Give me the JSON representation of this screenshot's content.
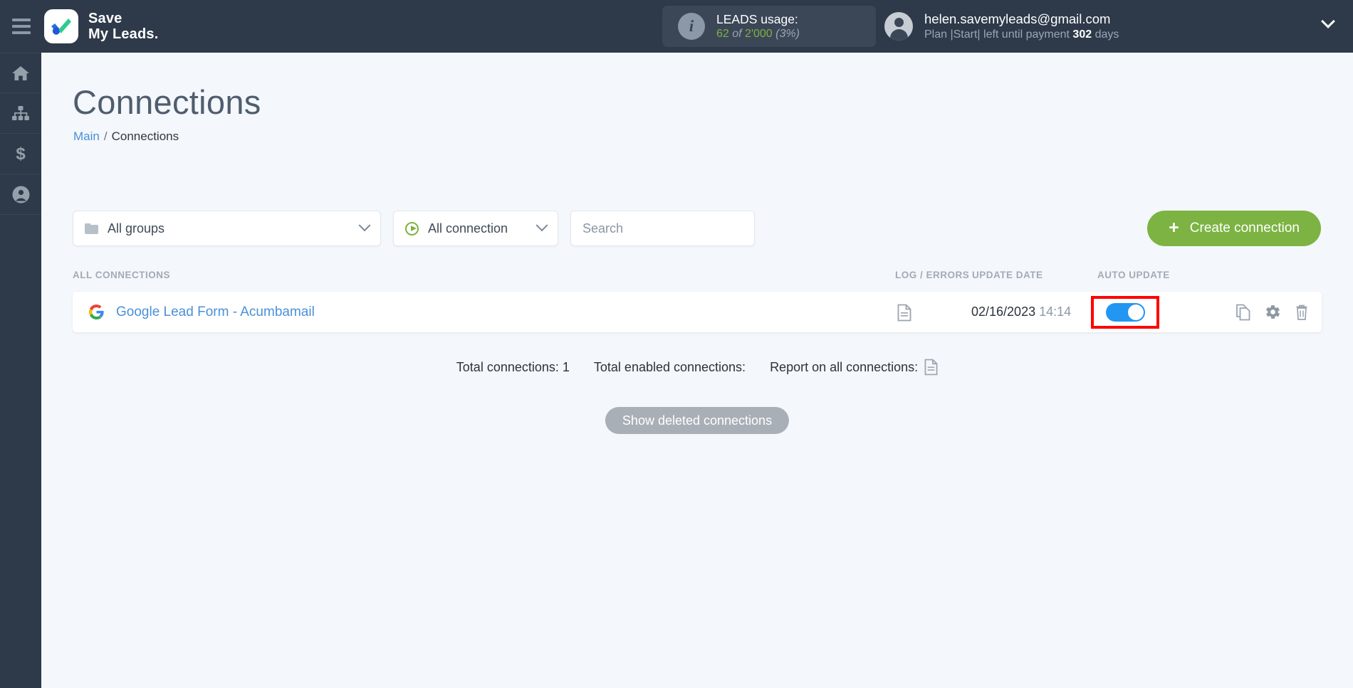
{
  "header": {
    "menu_icon": "hamburger-icon",
    "brand_line1": "Save",
    "brand_line2": "My Leads.",
    "leads": {
      "label": "LEADS usage:",
      "used": "62",
      "of": "of",
      "total": "2'000",
      "percent": "(3%)",
      "info_icon": "info-icon"
    },
    "account": {
      "email": "helen.savemyleads@gmail.com",
      "plan_prefix": "Plan |Start| left until payment",
      "days_value": "302",
      "days_suffix": "days",
      "avatar_icon": "user-avatar-icon",
      "chevron_icon": "chevron-down-icon"
    }
  },
  "sidebar": {
    "items": [
      {
        "name": "home",
        "icon": "home-icon"
      },
      {
        "name": "connections",
        "icon": "sitemap-icon"
      },
      {
        "name": "billing",
        "icon": "dollar-icon"
      },
      {
        "name": "profile",
        "icon": "user-circle-icon"
      }
    ]
  },
  "page": {
    "title": "Connections",
    "breadcrumb": {
      "root": "Main",
      "separator": "/",
      "current": "Connections"
    }
  },
  "filters": {
    "groups_select": {
      "value": "All groups",
      "icon": "folder-icon",
      "chevron": "chevron-down-icon"
    },
    "connection_select": {
      "value": "All connection",
      "icon": "play-circle-icon",
      "chevron": "chevron-down-icon"
    },
    "search": {
      "value": "",
      "placeholder": "Search"
    },
    "create_button": {
      "label": "Create connection",
      "icon": "plus-icon",
      "color": "#7cb342"
    }
  },
  "table": {
    "columns": {
      "name": "ALL CONNECTIONS",
      "log": "LOG / ERRORS",
      "date": "UPDATE DATE",
      "auto": "AUTO UPDATE"
    },
    "rows": [
      {
        "icon": "google-icon",
        "name": "Google Lead Form - Acumbamail",
        "log_icon": "document-icon",
        "date": "02/16/2023",
        "time": "14:14",
        "auto_update": true,
        "highlighted": true,
        "actions": [
          "copy-icon",
          "gear-icon",
          "trash-icon"
        ]
      }
    ]
  },
  "footer": {
    "total_connections": "Total connections: 1",
    "total_enabled": "Total enabled connections:",
    "report_label": "Report on all connections:",
    "report_icon": "document-icon",
    "show_deleted_button": "Show deleted connections"
  }
}
